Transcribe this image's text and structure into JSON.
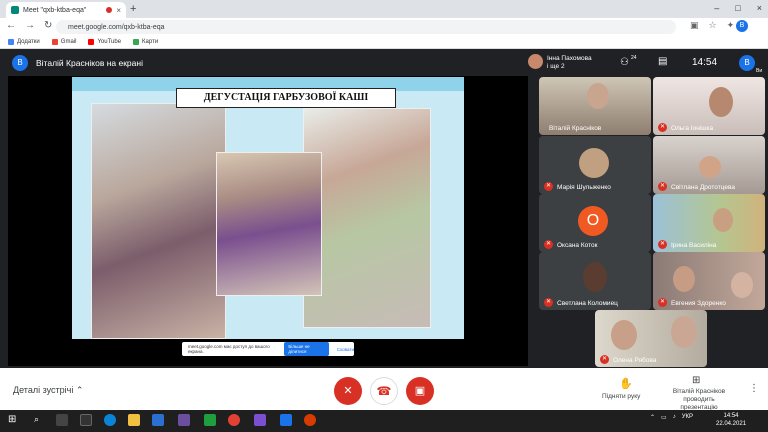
{
  "browser": {
    "tab_title": "Meet \"qxb-ktba-eqa\"",
    "tab_close": "×",
    "new_tab": "+",
    "url": "meet.google.com/qxb-ktba-eqa",
    "profile_initial": "В",
    "window_controls": [
      "–",
      "□",
      "×"
    ],
    "bookmarks": [
      "Додатки",
      "Gmail",
      "YouTube",
      "Карти"
    ]
  },
  "meet": {
    "presenter_initial": "В",
    "presenter_title": "Віталій Красніков на екрані",
    "slide_title": "ДЕГУСТАЦІЯ ГАРБУЗОВОЇ КАШІ",
    "notify_text": "meet.google.com має доступ до вашого екрана.",
    "notify_stop": "Більше не ділитися",
    "notify_hide": "Сховати",
    "top_participant_name": "Інна Пахомова",
    "top_participant_more": "і ще 2",
    "participant_count": "24",
    "clock": "14:54",
    "you_initial": "В",
    "you_label": "Ви",
    "tiles": [
      {
        "name": "Віталій Красніков",
        "muted": false
      },
      {
        "name": "Ольга Іонішка",
        "muted": true
      },
      {
        "name": "Марія Шульженко",
        "muted": true
      },
      {
        "name": "Світлана Дрототцева",
        "muted": true
      },
      {
        "name": "Оксана Коток",
        "muted": true,
        "initial": "О"
      },
      {
        "name": "Ірина Василіна",
        "muted": true
      },
      {
        "name": "Светлана Коломиец",
        "muted": true
      },
      {
        "name": "Евгения Здоренко",
        "muted": true
      },
      {
        "name": "Олена Рябова",
        "muted": true
      }
    ],
    "bottom": {
      "details": "Деталі зустрічі",
      "raise_hand": "Підняти руку",
      "presenting_line1": "Віталій Красніков",
      "presenting_line2": "проводить презентацію"
    }
  },
  "taskbar": {
    "lang": "УКР",
    "time": "14:54",
    "date": "22.04.2021"
  }
}
